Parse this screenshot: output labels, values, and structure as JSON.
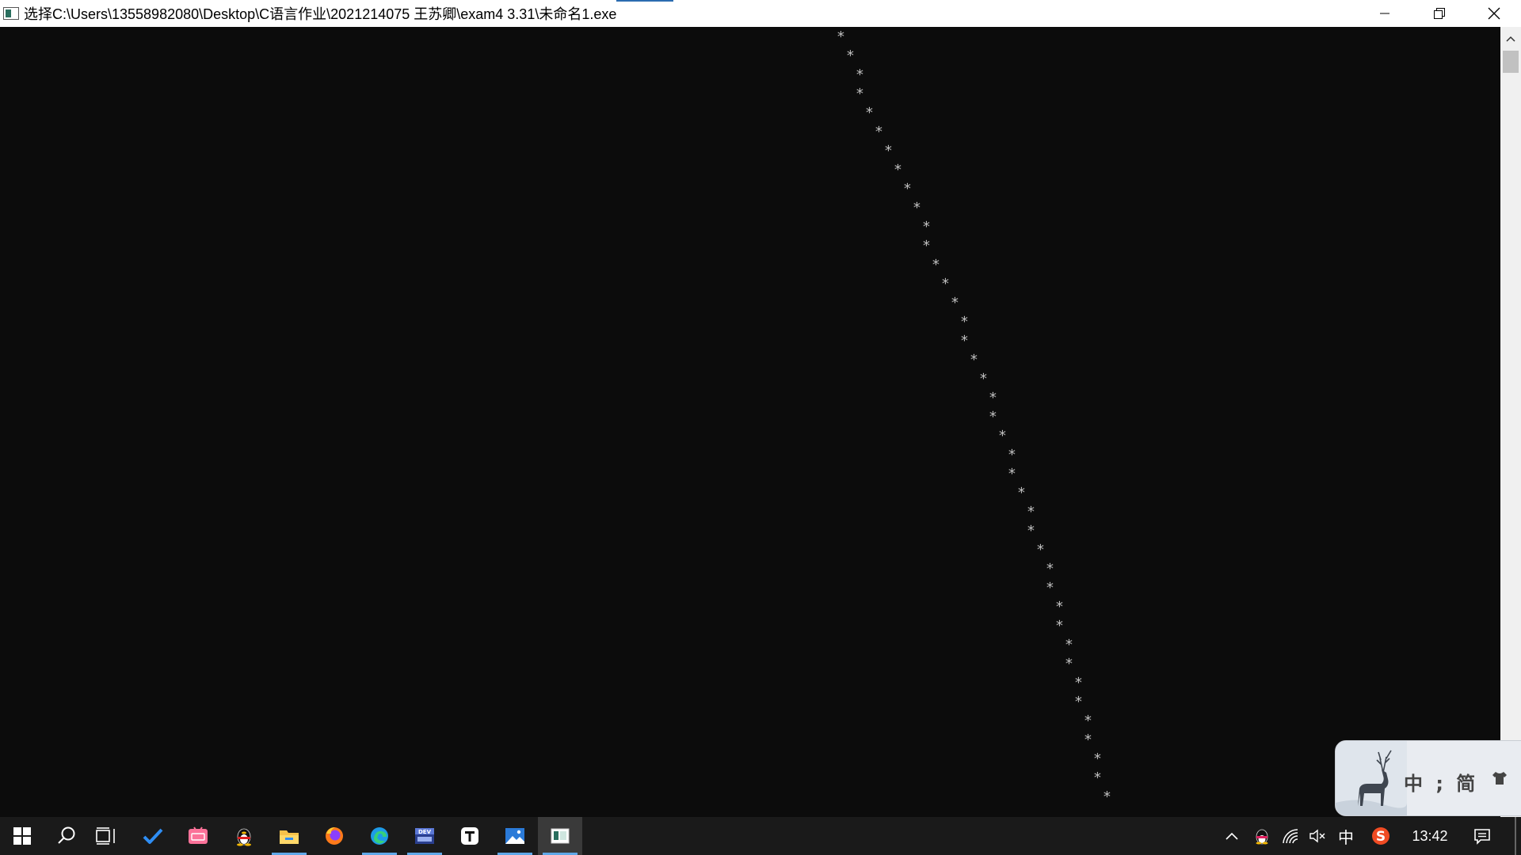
{
  "window": {
    "title": "选择C:\\Users\\13558982080\\Desktop\\C语言作业\\2021214075 王苏卿\\exam4 3.31\\未命名1.exe",
    "controls": [
      "minimize",
      "restore",
      "close"
    ]
  },
  "console": {
    "text_color": "#c0c0c0",
    "background": "#0c0c0c",
    "output_lines": [
      "*",
      "*",
      "*",
      "*",
      "*",
      "*",
      "*",
      "*",
      "*",
      "*",
      "*",
      "*",
      "*",
      "*",
      "*",
      "*",
      "*",
      "*",
      "*",
      "*",
      "*",
      "*",
      "*",
      "*",
      "*",
      "*",
      "*",
      "*",
      "*",
      "*",
      "*",
      "*",
      "*",
      "*",
      "*",
      "*",
      "*",
      "*",
      "*",
      "*",
      "*"
    ],
    "line_columns": [
      0,
      1,
      2,
      2,
      3,
      4,
      5,
      6,
      7,
      8,
      9,
      9,
      10,
      11,
      12,
      13,
      13,
      14,
      15,
      16,
      16,
      17,
      18,
      18,
      19,
      20,
      20,
      21,
      22,
      22,
      23,
      23,
      24,
      24,
      25,
      25,
      26,
      26,
      27,
      27,
      28
    ]
  },
  "ime": {
    "label": "中 ; 简",
    "icons": [
      "deer-logo",
      "skin-shirt-icon"
    ]
  },
  "taskbar": {
    "apps": [
      {
        "icon": "windows-start-icon"
      },
      {
        "icon": "search-icon"
      },
      {
        "icon": "task-view-icon"
      },
      {
        "icon": "todo-check-icon"
      },
      {
        "icon": "bilibili-icon"
      },
      {
        "icon": "qq-penguin-icon"
      },
      {
        "icon": "file-explorer-icon"
      },
      {
        "icon": "firefox-icon"
      },
      {
        "icon": "edge-icon"
      },
      {
        "icon": "devcpp-icon"
      },
      {
        "icon": "typora-icon"
      },
      {
        "icon": "photos-icon"
      },
      {
        "icon": "console-app-icon"
      }
    ],
    "tray": {
      "input_mode": "中",
      "time": "13:42"
    }
  }
}
